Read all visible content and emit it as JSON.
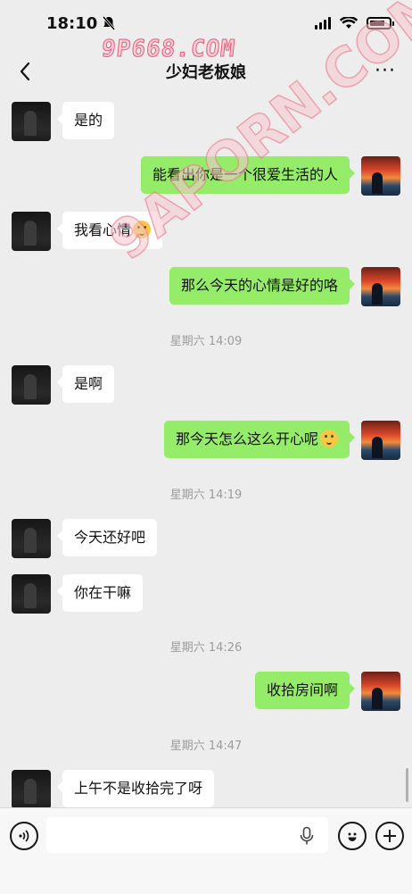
{
  "status_bar": {
    "time": "18:10"
  },
  "watermark": {
    "top": "9P668.COM",
    "diagonal": "9APORN.COM"
  },
  "nav": {
    "title": "少妇老板娘",
    "more": "···"
  },
  "messages": [
    {
      "side": "left",
      "text": "是的"
    },
    {
      "side": "right",
      "text": "能看出你是一个很爱生活的人"
    },
    {
      "side": "left",
      "text": "我看心情",
      "emoji": "thinking-face"
    },
    {
      "side": "right",
      "text": "那么今天的心情是好的咯"
    },
    {
      "type": "time",
      "text": "星期六 14:09"
    },
    {
      "side": "left",
      "text": "是啊"
    },
    {
      "side": "right",
      "text": "那今天怎么这么开心呢",
      "emoji": "rolling-eyes-face"
    },
    {
      "type": "time",
      "text": "星期六 14:19"
    },
    {
      "side": "left",
      "text": "今天还好吧"
    },
    {
      "side": "left",
      "text": "你在干嘛"
    },
    {
      "type": "time",
      "text": "星期六 14:26"
    },
    {
      "side": "right",
      "text": "收拾房间啊"
    },
    {
      "type": "time",
      "text": "星期六 14:47"
    },
    {
      "side": "left",
      "text": "上午不是收拾完了呀"
    }
  ],
  "input_bar": {
    "icons": [
      "voice-icon",
      "microphone-icon",
      "emoji-icon",
      "plus-icon"
    ]
  },
  "colors": {
    "background": "#ededed",
    "bubble_right": "#95ec69",
    "bubble_left": "#ffffff",
    "timestamp": "#9c9c9c"
  }
}
